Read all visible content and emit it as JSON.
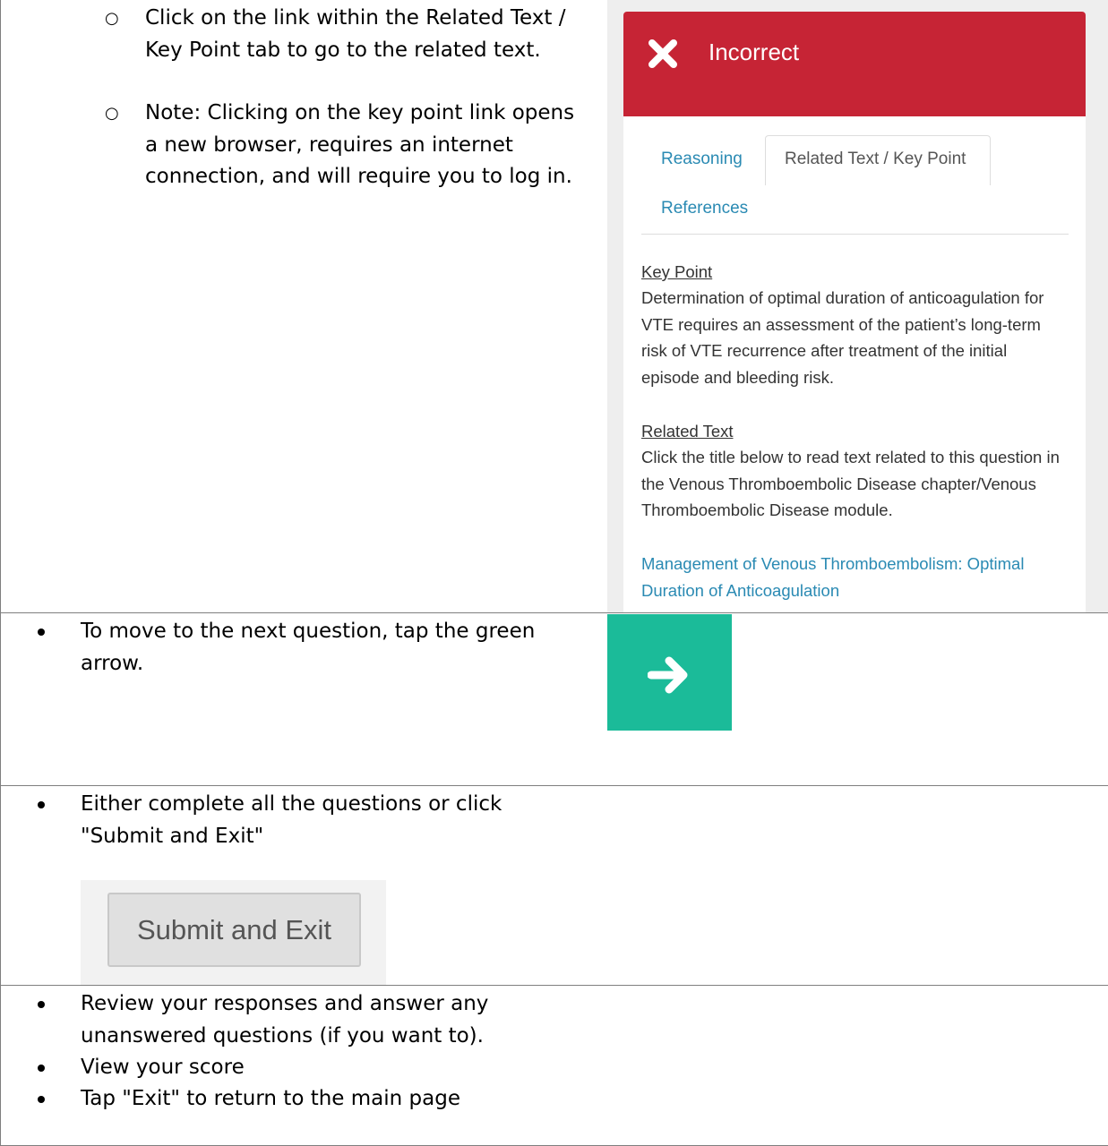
{
  "row1": {
    "sub_items": [
      {
        "text": "Click on the link within the Related Text / Key Point tab to go to the related text."
      },
      {
        "text": "Note: Clicking on the key point link opens a new browser, requires an internet connection, and will require you to log in."
      }
    ],
    "sub_bullet_glyph": "○",
    "app": {
      "banner": {
        "label": "Incorrect",
        "icon": "close-x-icon",
        "color": "#c62435"
      },
      "tabs": {
        "reasoning": "Reasoning",
        "related": "Related Text / Key Point",
        "references": "References"
      },
      "key_point": {
        "heading": "Key Point",
        "body": "Determination of optimal duration of anticoagulation for VTE requires an assessment of the patient’s long-term risk of VTE recurrence after treatment of the initial episode and bleeding risk."
      },
      "related_text": {
        "heading": "Related Text",
        "body": "Click the title below to read text related to this question in the Venous Thromboembolic Disease chapter/Venous Thromboembolic Disease module.",
        "link": "Management of Venous Thromboembolism: Optimal Duration of Anticoagulation"
      },
      "link_color": "#2a8ab3"
    }
  },
  "row2": {
    "bullet": "To move to the next question, tap the green arrow.",
    "next_button": {
      "icon": "arrow-right-icon",
      "color": "#1bbb99"
    }
  },
  "row3": {
    "bullet": "Either complete all the questions or click \"Submit and Exit\"",
    "submit_label": "Submit and Exit"
  },
  "row4": {
    "bullets": [
      "Review your responses and answer any unanswered questions (if you want to).",
      "View your score",
      "Tap \"Exit\" to return to the main page"
    ]
  }
}
